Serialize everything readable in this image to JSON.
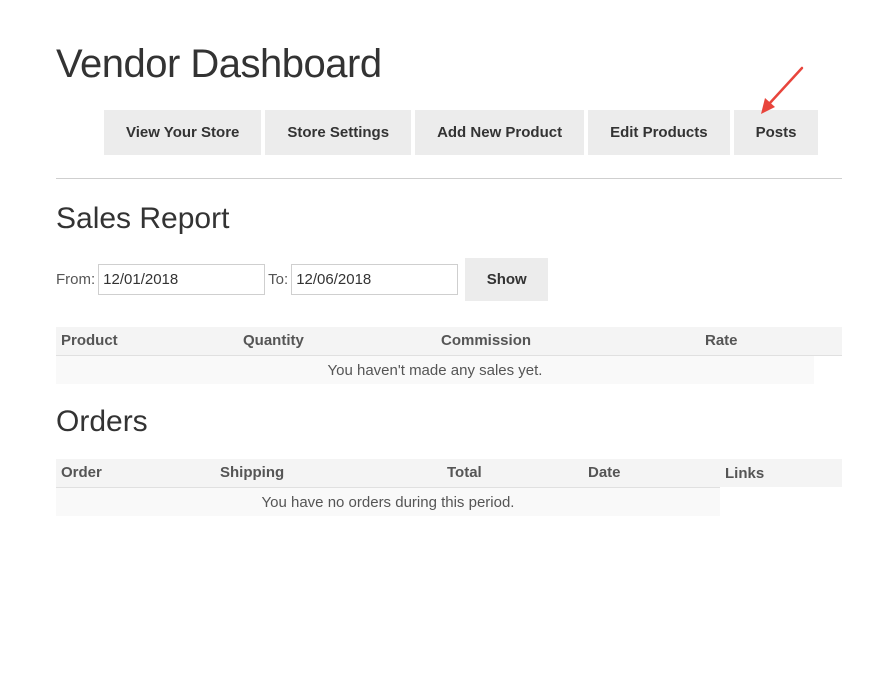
{
  "header": {
    "title": "Vendor Dashboard"
  },
  "nav": {
    "items": [
      {
        "label": "View Your Store"
      },
      {
        "label": "Store Settings"
      },
      {
        "label": "Add New Product"
      },
      {
        "label": "Edit Products"
      },
      {
        "label": "Posts"
      }
    ]
  },
  "sales_report": {
    "title": "Sales Report",
    "from_label": "From:",
    "from_value": "12/01/2018",
    "to_label": "To:",
    "to_value": "12/06/2018",
    "show_label": "Show",
    "columns": [
      "Product",
      "Quantity",
      "Commission",
      "Rate"
    ],
    "empty_message": "You haven't made any sales yet."
  },
  "orders": {
    "title": "Orders",
    "columns": [
      "Order",
      "Shipping",
      "Total",
      "Date",
      "Links"
    ],
    "empty_message": "You have no orders during this period."
  },
  "colors": {
    "button_bg": "#ececec",
    "annotation_arrow": "#e8453c"
  }
}
